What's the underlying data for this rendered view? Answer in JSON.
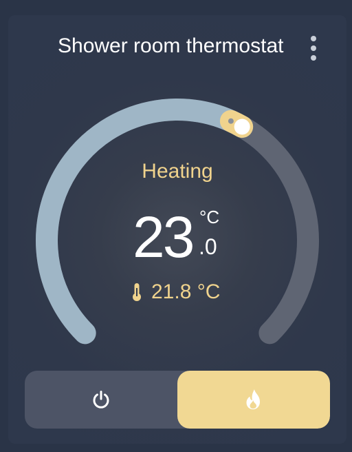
{
  "card": {
    "title": "Shower room thermostat",
    "menu_icon": "dots-vertical-icon"
  },
  "thermostat": {
    "hvac_action": "Heating",
    "target_integer": "23",
    "target_decimal": ".0",
    "target_unit": "°C",
    "target_value": 23.0,
    "current_temperature": "21.8 °C",
    "current_icon": "thermometer-icon",
    "slider_fraction": 0.61,
    "colors": {
      "arc_active": "#9fb6c6",
      "arc_inactive": "#5f6573",
      "accent": "#f0d38d",
      "handle": "#ffffff"
    }
  },
  "modes": {
    "off": {
      "icon": "power-icon"
    },
    "heat": {
      "icon": "fire-icon",
      "selected": true
    }
  }
}
